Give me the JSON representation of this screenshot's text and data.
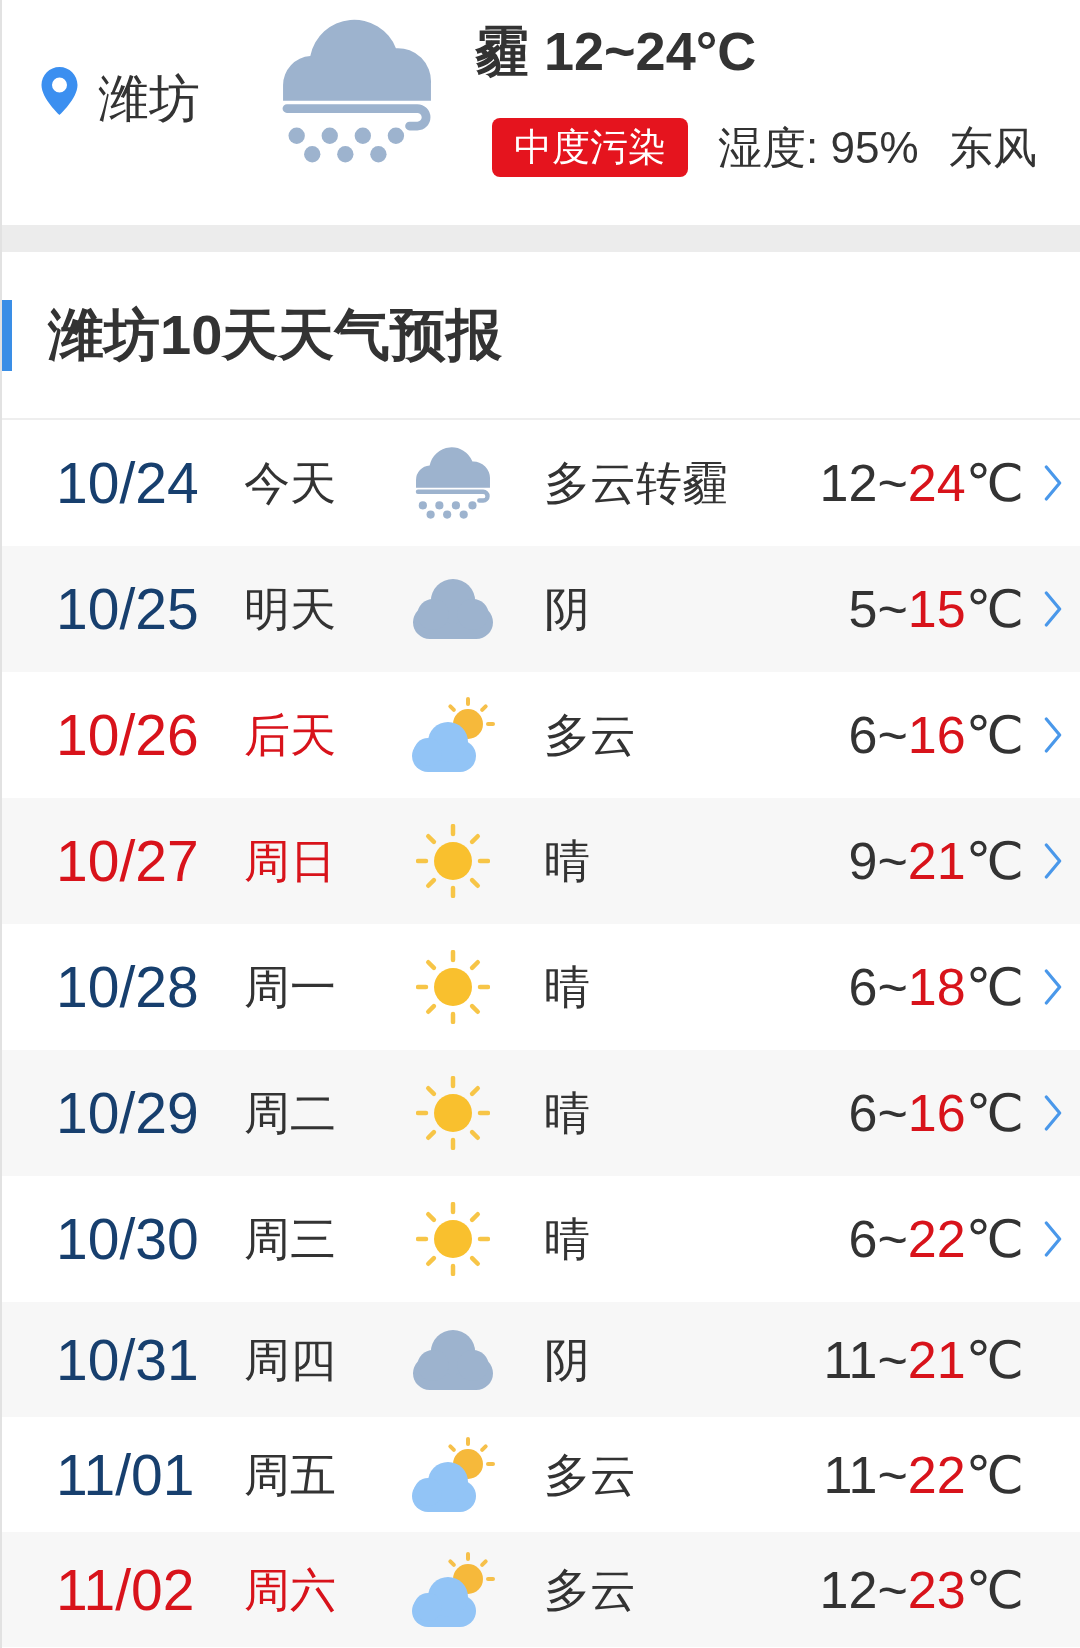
{
  "header": {
    "location": "潍坊",
    "kind": "haze",
    "summary": "霾 12~24°C",
    "air_quality": "中度污染",
    "humidity": "湿度: 95%",
    "wind": "东风"
  },
  "forecast": {
    "title": "潍坊10天天气预报",
    "days": [
      {
        "date": "10/24",
        "day": "今天",
        "weekend": false,
        "kind": "haze",
        "condition": "多云转霾",
        "low": "12",
        "separator": "~",
        "high": "24",
        "unit": "℃",
        "has_details": true
      },
      {
        "date": "10/25",
        "day": "明天",
        "weekend": false,
        "kind": "overcast",
        "condition": "阴",
        "low": "5",
        "separator": "~",
        "high": "15",
        "unit": "℃",
        "has_details": true
      },
      {
        "date": "10/26",
        "day": "后天",
        "weekend": true,
        "kind": "partly_cloudy",
        "condition": "多云",
        "low": "6",
        "separator": "~",
        "high": "16",
        "unit": "℃",
        "has_details": true
      },
      {
        "date": "10/27",
        "day": "周日",
        "weekend": true,
        "kind": "sunny",
        "condition": "晴",
        "low": "9",
        "separator": "~",
        "high": "21",
        "unit": "℃",
        "has_details": true
      },
      {
        "date": "10/28",
        "day": "周一",
        "weekend": false,
        "kind": "sunny",
        "condition": "晴",
        "low": "6",
        "separator": "~",
        "high": "18",
        "unit": "℃",
        "has_details": true
      },
      {
        "date": "10/29",
        "day": "周二",
        "weekend": false,
        "kind": "sunny",
        "condition": "晴",
        "low": "6",
        "separator": "~",
        "high": "16",
        "unit": "℃",
        "has_details": true
      },
      {
        "date": "10/30",
        "day": "周三",
        "weekend": false,
        "kind": "sunny",
        "condition": "晴",
        "low": "6",
        "separator": "~",
        "high": "22",
        "unit": "℃",
        "has_details": true
      },
      {
        "date": "10/31",
        "day": "周四",
        "weekend": false,
        "kind": "overcast",
        "condition": "阴",
        "low": "11",
        "separator": "~",
        "high": "21",
        "unit": "℃",
        "has_details": false
      },
      {
        "date": "11/01",
        "day": "周五",
        "weekend": false,
        "kind": "partly_cloudy",
        "condition": "多云",
        "low": "11",
        "separator": "~",
        "high": "22",
        "unit": "℃",
        "has_details": false
      },
      {
        "date": "11/02",
        "day": "周六",
        "weekend": true,
        "kind": "partly_cloudy",
        "condition": "多云",
        "low": "12",
        "separator": "~",
        "high": "23",
        "unit": "℃",
        "has_details": false
      }
    ]
  }
}
